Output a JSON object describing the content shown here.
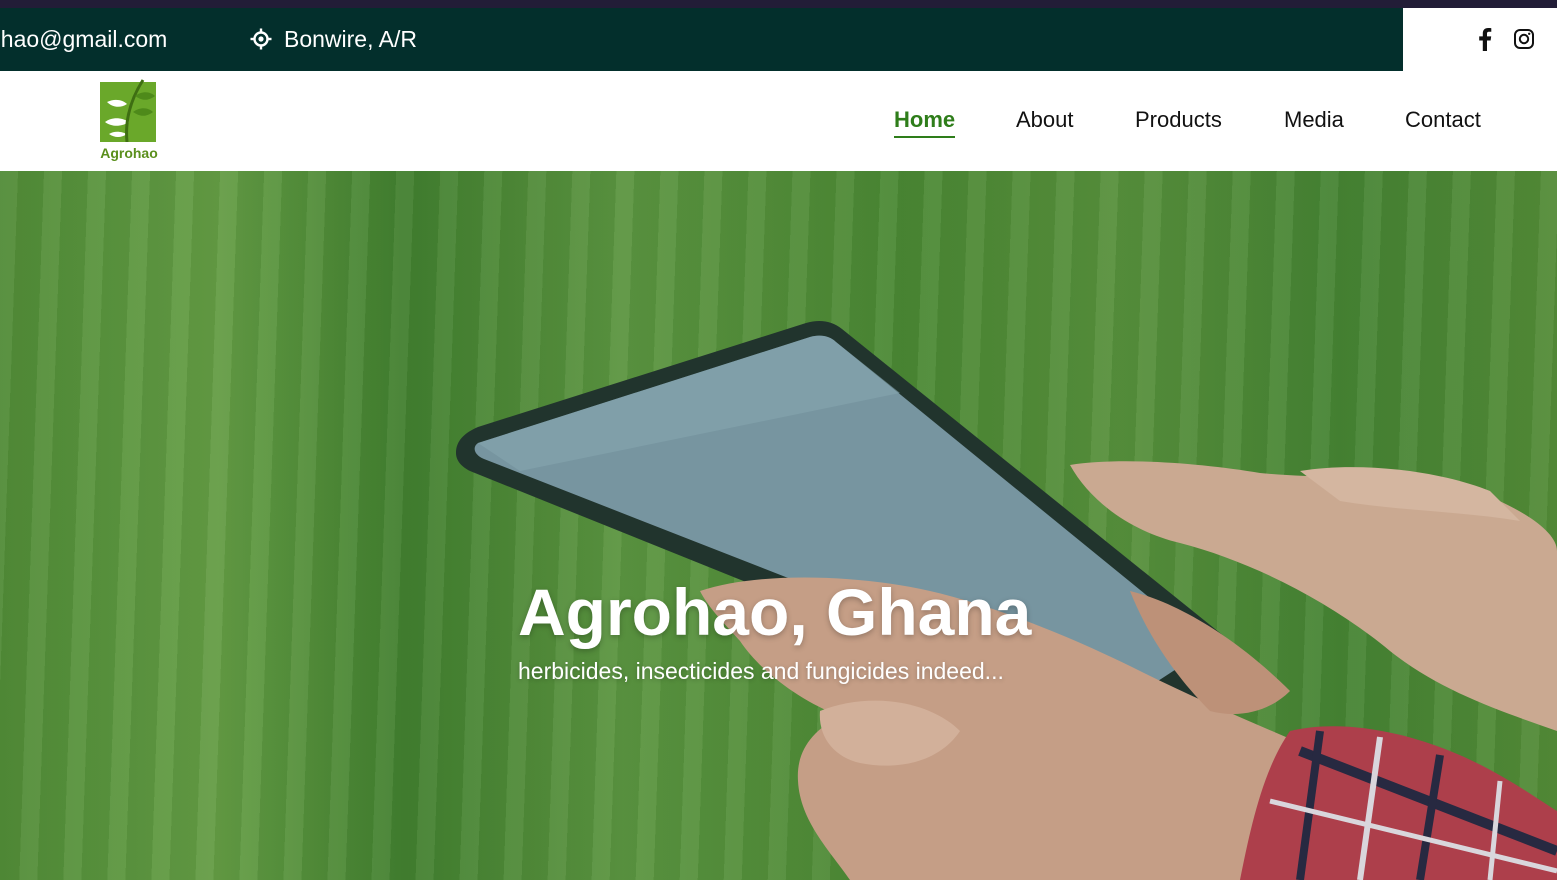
{
  "topbar": {
    "email": "ohao@gmail.com",
    "location": "Bonwire, A/R",
    "location_icon": "location-target-icon",
    "background_color": "#032f2c"
  },
  "social": {
    "facebook_icon": "facebook-icon",
    "instagram_icon": "instagram-icon"
  },
  "brand": {
    "logo_text": "Agrohao",
    "logo_color": "#5a8f1c"
  },
  "nav": {
    "items": [
      {
        "label": "Home",
        "active": true
      },
      {
        "label": "About",
        "active": false
      },
      {
        "label": "Products",
        "active": false
      },
      {
        "label": "Media",
        "active": false
      },
      {
        "label": "Contact",
        "active": false
      }
    ],
    "active_color": "#2e7d1a"
  },
  "hero": {
    "title": "Agrohao, Ghana",
    "subtitle": "herbicides, insecticides and fungicides indeed..."
  }
}
